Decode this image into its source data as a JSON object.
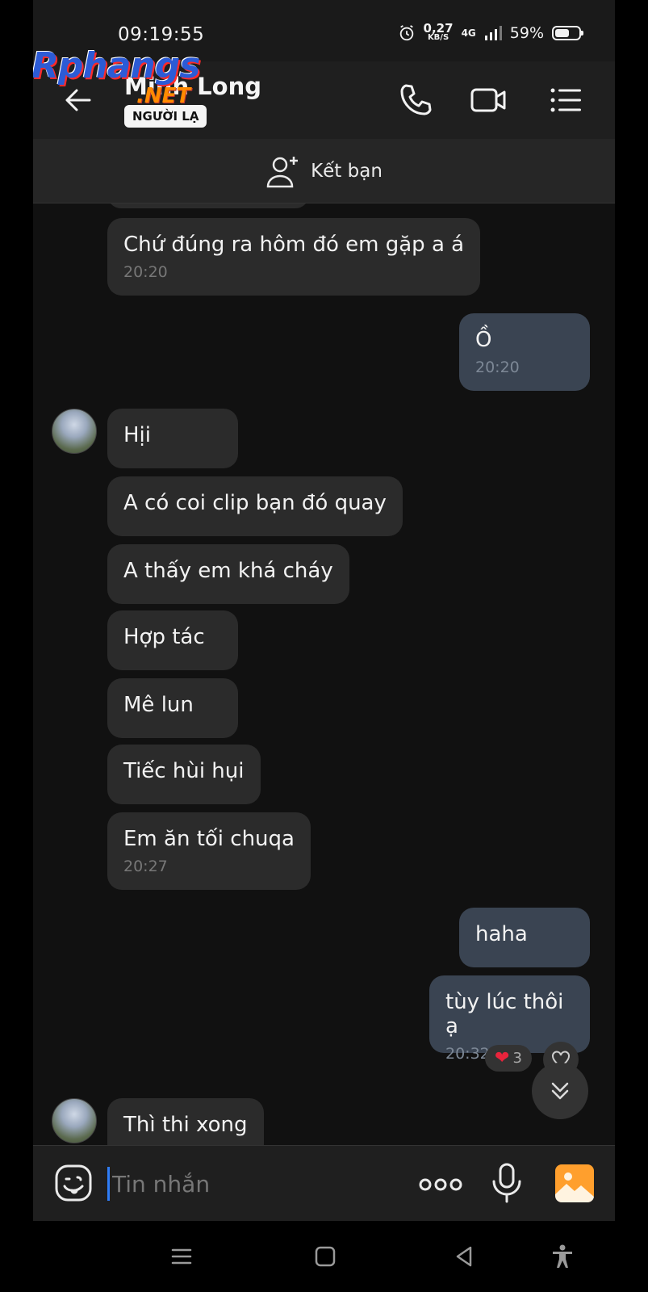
{
  "status_bar": {
    "time": "09:19:55",
    "speed_value": "0,27",
    "speed_unit": "KB/S",
    "network": "4G",
    "battery": "59%"
  },
  "header": {
    "contact_name": "Minh Long",
    "badge": "NGƯỜI LẠ",
    "watermark_main": "Rphangs",
    "watermark_sub": ".NET"
  },
  "add_friend": {
    "label": "Kết bạn"
  },
  "messages": [
    {
      "side": "in",
      "text": "Chứ đúng ra hôm đó em gặp a á",
      "time": "20:20"
    },
    {
      "side": "out",
      "text": "Ồ",
      "time": "20:20"
    },
    {
      "side": "in",
      "text": "Hịi",
      "time": ""
    },
    {
      "side": "in",
      "text": "A có coi clip bạn đó quay",
      "time": ""
    },
    {
      "side": "in",
      "text": "A thấy em khá cháy",
      "time": ""
    },
    {
      "side": "in",
      "text": "Hợp tác",
      "time": ""
    },
    {
      "side": "in",
      "text": "Mê lun",
      "time": ""
    },
    {
      "side": "in",
      "text": "Tiếc hùi hụi",
      "time": ""
    },
    {
      "side": "in",
      "text": "Em ăn tối chuqa",
      "time": "20:27"
    },
    {
      "side": "out",
      "text": "haha",
      "time": ""
    },
    {
      "side": "out",
      "text": "tùy lúc thôi ạ",
      "time": "20:32"
    },
    {
      "side": "in",
      "text": "Thì thi xong",
      "time": ""
    }
  ],
  "reaction": {
    "emoji": "❤",
    "count": "3"
  },
  "composer": {
    "placeholder": "Tin nhắn"
  },
  "colors": {
    "background": "#111111",
    "incoming_bubble": "#2b2b2b",
    "outgoing_bubble": "#3a4452",
    "cursor": "#2f7df6",
    "gallery_icon": "#ff9f2d"
  }
}
